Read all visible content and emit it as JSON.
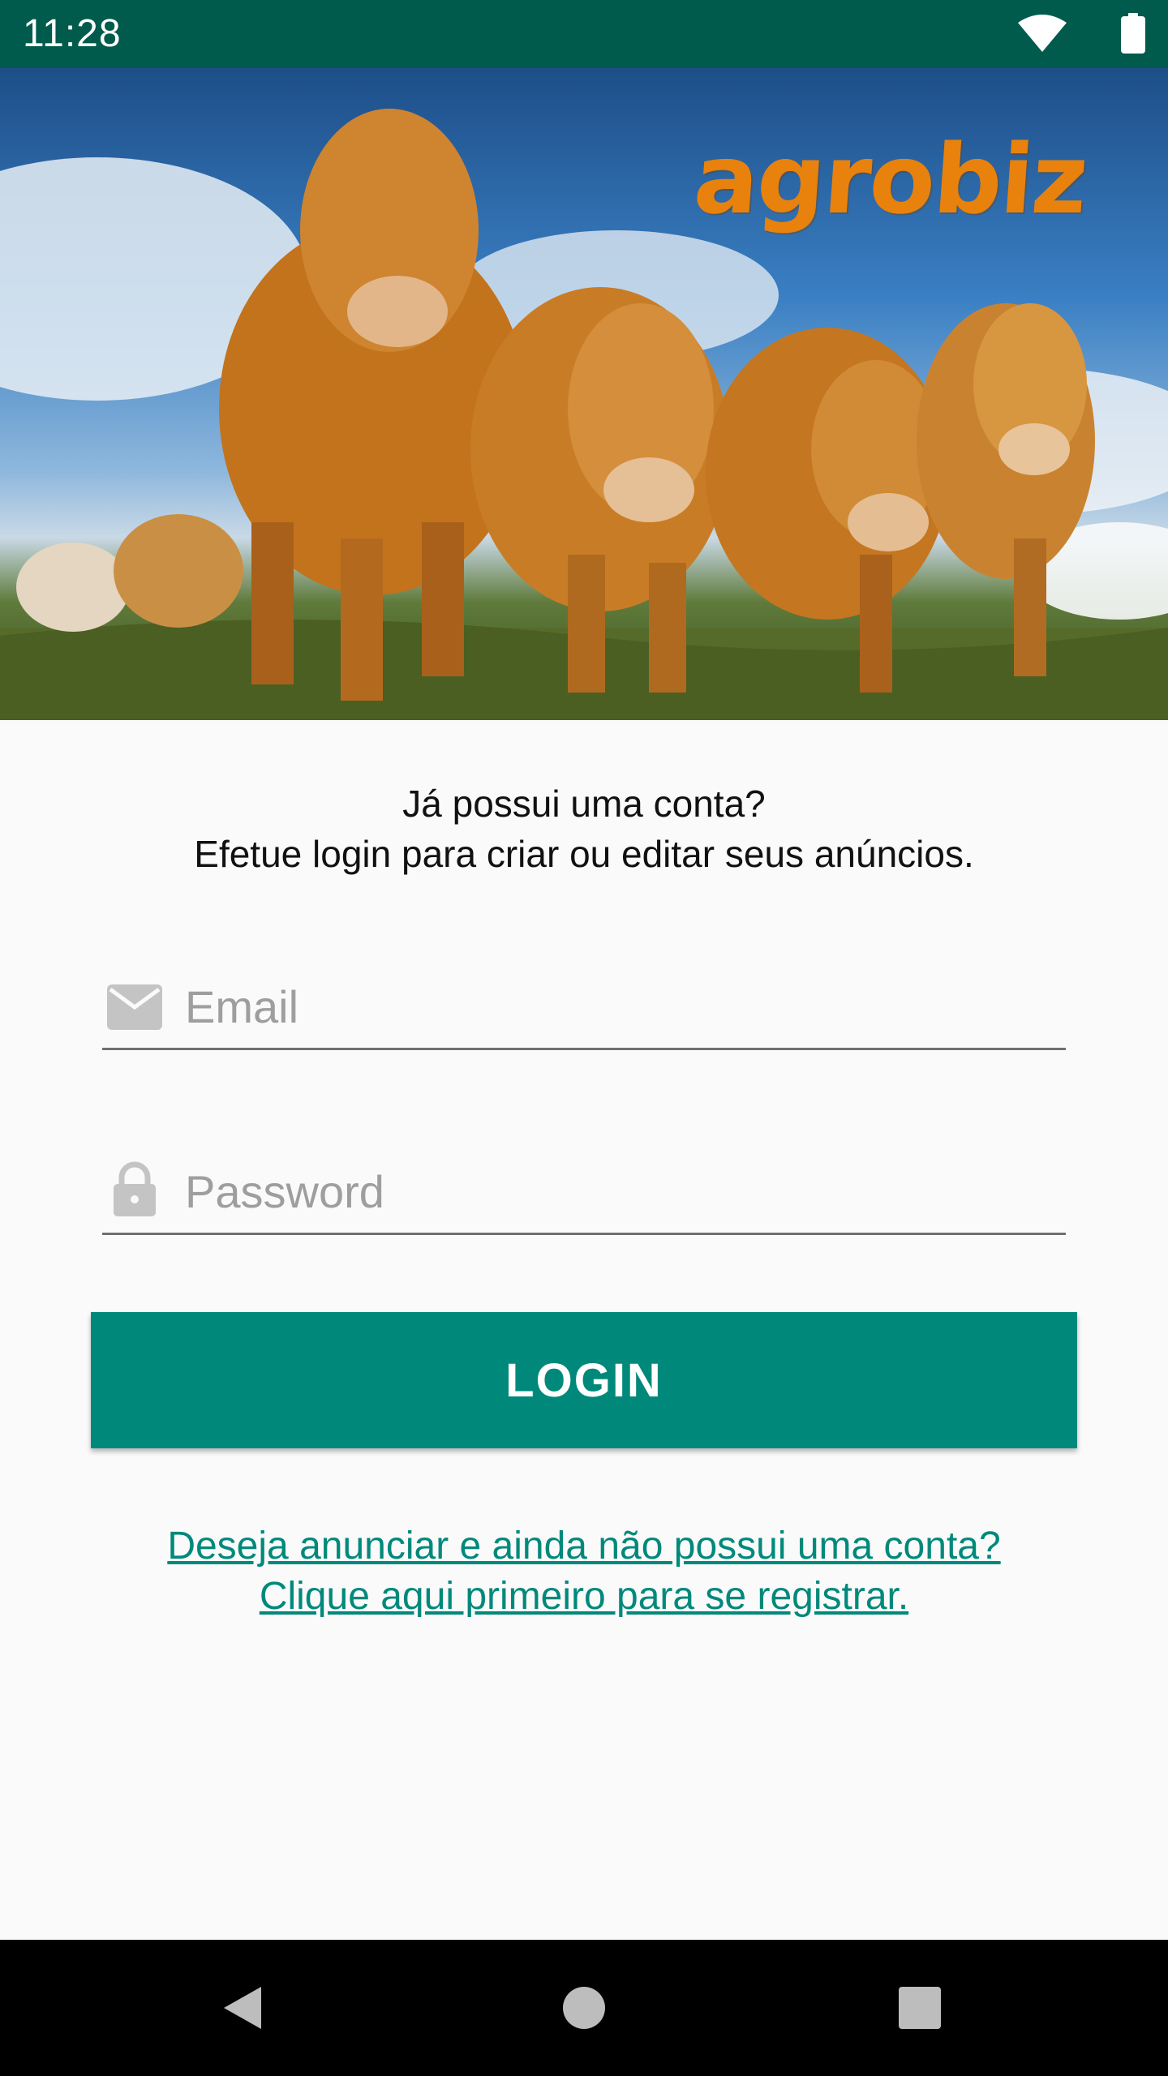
{
  "status_bar": {
    "time": "11:28",
    "icons": [
      "wifi-icon",
      "battery-icon"
    ],
    "color": "#005b4c"
  },
  "hero": {
    "brand": "agrobiz",
    "image": "herd-of-cows-photo"
  },
  "intro": {
    "line1": "Já possui uma conta?",
    "line2": "Efetue login para criar ou editar seus anúncios."
  },
  "form": {
    "email": {
      "placeholder": "Email",
      "value": "",
      "icon": "mail-icon"
    },
    "password": {
      "placeholder": "Password",
      "value": "",
      "icon": "lock-icon"
    },
    "login_label": "LOGIN",
    "accent": "#00897b"
  },
  "register": {
    "line1": "Deseja anunciar e ainda não possui uma conta?",
    "line2": "Clique aqui primeiro para se registrar."
  },
  "nav": {
    "buttons": [
      "back-icon",
      "home-icon",
      "recents-icon"
    ]
  }
}
